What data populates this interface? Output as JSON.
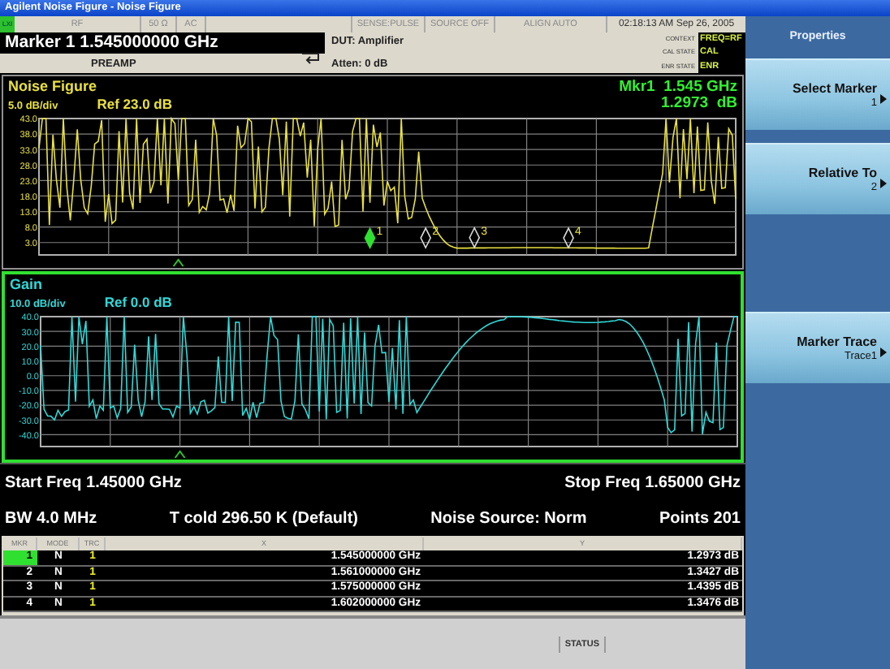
{
  "window": {
    "title": "Agilent Noise Figure - Noise Figure"
  },
  "status_strip": {
    "badge": "LXI",
    "cells": [
      "RF",
      "50 Ω",
      "AC",
      "SENSE:PULSE",
      "SOURCE OFF",
      "ALIGN AUTO"
    ],
    "datetime": "02:18:13 AM Sep 26, 2005"
  },
  "active_function": "Marker 1 1.545000000 GHz",
  "preamp": "PREAMP",
  "dut": "DUT: Amplifier",
  "atten": "Atten: 0 dB",
  "states": [
    {
      "label": "CONTEXT",
      "value": "FREQ=RF"
    },
    {
      "label": "CAL STATE",
      "value": "CAL"
    },
    {
      "label": "ENR STATE",
      "value": "ENR"
    }
  ],
  "graphs": [
    {
      "kind": "noise_figure",
      "title": "Noise Figure",
      "scale": "5.0 dB/div",
      "ref": "Ref 23.0 dB",
      "color": "#e8e040",
      "selected": false,
      "readout": [
        "Mkr1  1.545 GHz",
        "1.2973  dB"
      ],
      "yticks": [
        "43.0",
        "38.0",
        "33.0",
        "28.0",
        "23.0",
        "18.0",
        "13.0",
        "8.0",
        "3.0"
      ],
      "markers": [
        {
          "label": "1",
          "selected": true
        },
        {
          "label": "2",
          "selected": false
        },
        {
          "label": "3",
          "selected": false
        },
        {
          "label": "4",
          "selected": false
        }
      ]
    },
    {
      "kind": "gain",
      "title": "Gain",
      "scale": "10.0 dB/div",
      "ref": "Ref 0.0 dB",
      "color": "#30d8d8",
      "selected": true,
      "yticks": [
        "40.0",
        "30.0",
        "20.0",
        "10.0",
        "0.0",
        "-10.0",
        "-20.0",
        "-30.0",
        "-40.0"
      ]
    }
  ],
  "sweep": {
    "start": "Start Freq 1.45000 GHz",
    "stop": "Stop Freq 1.65000 GHz"
  },
  "settings": [
    "BW 4.0 MHz",
    "T cold 296.50 K (Default)",
    "Noise Source: Norm",
    "Points 201"
  ],
  "table": {
    "columns": [
      "MKR",
      "MODE",
      "TRC",
      "X",
      "Y"
    ],
    "rows": [
      {
        "mkr": "1",
        "mode": "N",
        "trc": "1",
        "x": "1.545000000 GHz",
        "y": "1.2973 dB",
        "selected": true
      },
      {
        "mkr": "2",
        "mode": "N",
        "trc": "1",
        "x": "1.561000000 GHz",
        "y": "1.3427 dB",
        "selected": false
      },
      {
        "mkr": "3",
        "mode": "N",
        "trc": "1",
        "x": "1.575000000 GHz",
        "y": "1.4395 dB",
        "selected": false
      },
      {
        "mkr": "4",
        "mode": "N",
        "trc": "1",
        "x": "1.602000000 GHz",
        "y": "1.3476 dB",
        "selected": false
      }
    ]
  },
  "status_bar": {
    "label": "STATUS"
  },
  "softkeys": {
    "title": "Properties",
    "keys": [
      {
        "kind": "key",
        "label": "Select Marker",
        "value": "1"
      },
      {
        "kind": "key",
        "label": "Relative To",
        "value": "2"
      },
      {
        "kind": "blank"
      },
      {
        "kind": "key",
        "label": "Marker Trace",
        "value": "Trace1"
      }
    ]
  }
}
